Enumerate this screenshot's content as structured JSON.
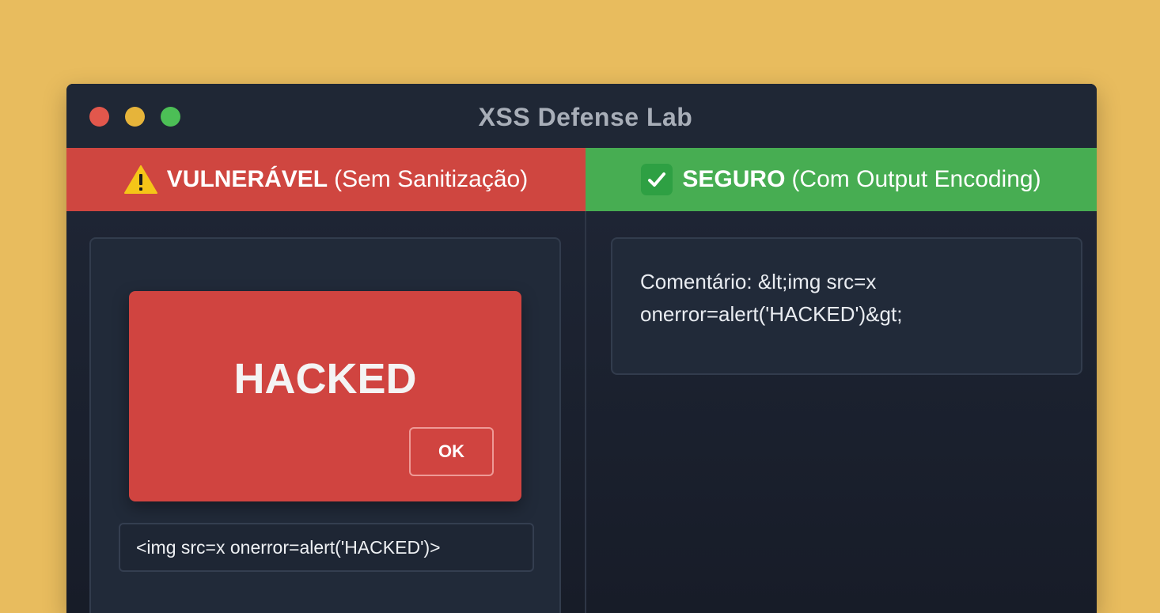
{
  "window": {
    "title": "XSS Defense Lab",
    "traffic_lights": [
      "close",
      "minimize",
      "maximize"
    ]
  },
  "left": {
    "banner_bold": "VULNERÁVEL",
    "banner_rest": "(Sem Sanitização)",
    "banner_icon": "warning-icon",
    "banner_color": "#cf4640",
    "alert": {
      "message": "HACKED",
      "ok_label": "OK"
    },
    "input_value": "<img src=x onerror=alert('HACKED')>"
  },
  "right": {
    "banner_bold": "SEGURO",
    "banner_rest": "(Com Output Encoding)",
    "banner_icon": "check-icon",
    "banner_color": "#47ad52",
    "output_line1": "Comentário: &lt;img src=x",
    "output_line2": "onerror=alert('HACKED')&gt;"
  }
}
